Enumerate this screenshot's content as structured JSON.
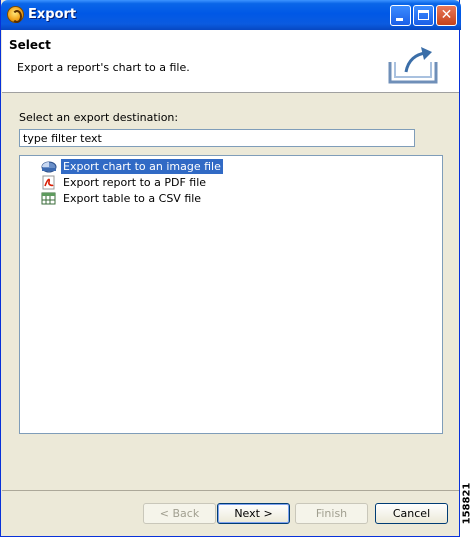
{
  "window": {
    "title": "Export"
  },
  "banner": {
    "title": "Select",
    "description": "Export a report's chart to a file."
  },
  "destination": {
    "label": "Select an export destination:",
    "filter_value": "type filter text"
  },
  "tree": {
    "items": [
      {
        "label": "Export chart to an image file",
        "icon": "image-file-icon",
        "selected": true
      },
      {
        "label": "Export report to a PDF file",
        "icon": "pdf-icon",
        "selected": false
      },
      {
        "label": "Export table to a CSV file",
        "icon": "csv-table-icon",
        "selected": false
      }
    ]
  },
  "buttons": {
    "back": "< Back",
    "next": "Next >",
    "finish": "Finish",
    "cancel": "Cancel"
  },
  "figure_id": "158821",
  "colors": {
    "selection": "#316ac5",
    "titlebar": "#0058e6"
  }
}
